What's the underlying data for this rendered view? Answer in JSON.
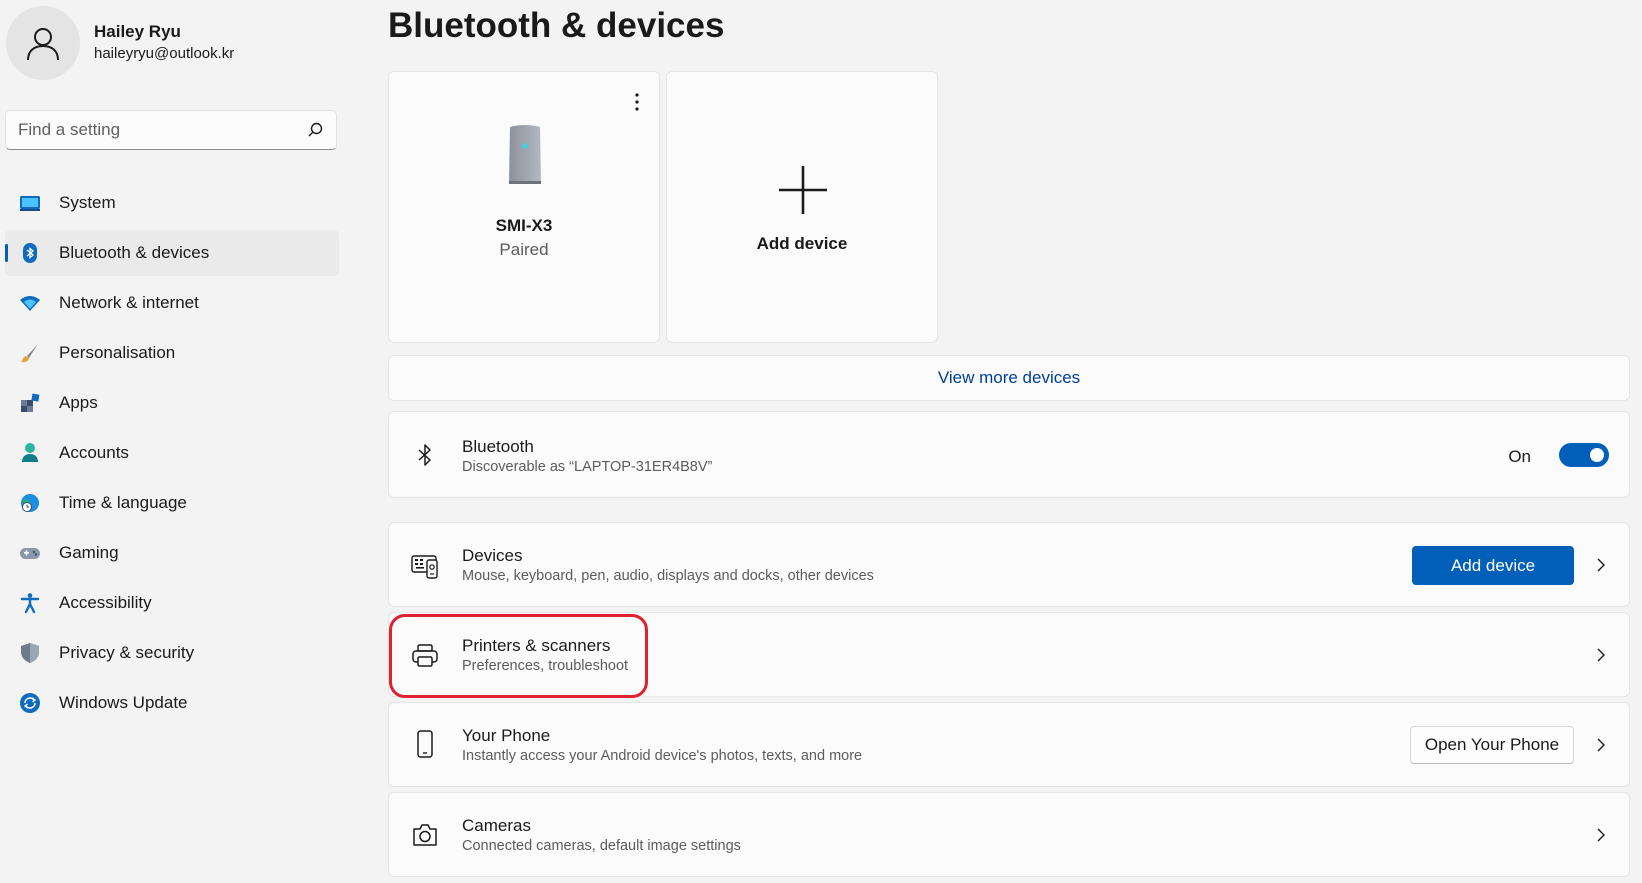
{
  "user": {
    "name": "Hailey Ryu",
    "email": "haileyryu@outlook.kr"
  },
  "search": {
    "placeholder": "Find a setting"
  },
  "nav": [
    {
      "label": "System",
      "icon": "system-icon",
      "active": false
    },
    {
      "label": "Bluetooth & devices",
      "icon": "bluetooth-icon",
      "active": true
    },
    {
      "label": "Network & internet",
      "icon": "wifi-icon",
      "active": false
    },
    {
      "label": "Personalisation",
      "icon": "brush-icon",
      "active": false
    },
    {
      "label": "Apps",
      "icon": "apps-icon",
      "active": false
    },
    {
      "label": "Accounts",
      "icon": "person-icon",
      "active": false
    },
    {
      "label": "Time & language",
      "icon": "globe-clock-icon",
      "active": false
    },
    {
      "label": "Gaming",
      "icon": "gamepad-icon",
      "active": false
    },
    {
      "label": "Accessibility",
      "icon": "accessibility-icon",
      "active": false
    },
    {
      "label": "Privacy & security",
      "icon": "shield-icon",
      "active": false
    },
    {
      "label": "Windows Update",
      "icon": "update-icon",
      "active": false
    }
  ],
  "page": {
    "title": "Bluetooth & devices"
  },
  "cards": {
    "device": {
      "name": "SMI-X3",
      "status": "Paired"
    },
    "add": {
      "label": "Add device"
    }
  },
  "view_more": "View more devices",
  "bluetooth": {
    "title": "Bluetooth",
    "subtitle": "Discoverable as “LAPTOP-31ER4B8V”",
    "state": "On",
    "toggle_on": true
  },
  "rows": {
    "devices": {
      "title": "Devices",
      "subtitle": "Mouse, keyboard, pen, audio, displays and docks, other devices",
      "button": "Add device"
    },
    "printers": {
      "title": "Printers & scanners",
      "subtitle": "Preferences, troubleshoot"
    },
    "phone": {
      "title": "Your Phone",
      "subtitle": "Instantly access your Android device's photos, texts, and more",
      "button": "Open Your Phone"
    },
    "cameras": {
      "title": "Cameras",
      "subtitle": "Connected cameras, default image settings"
    }
  },
  "colors": {
    "accent": "#005fb8",
    "highlight": "#e0202e",
    "link": "#003e92"
  }
}
